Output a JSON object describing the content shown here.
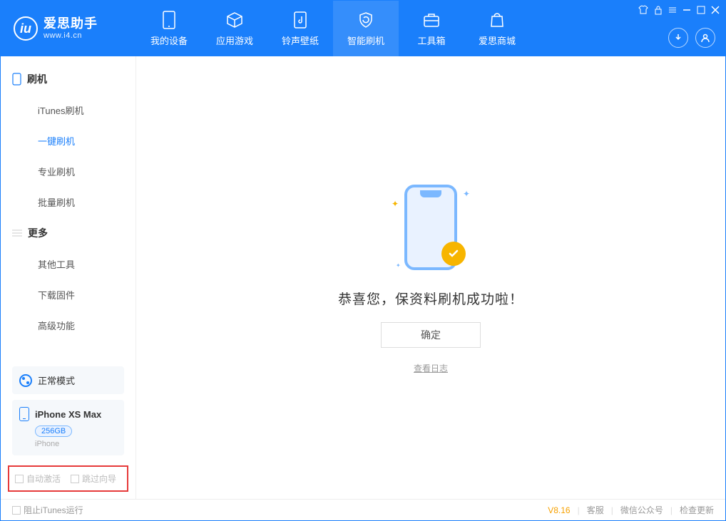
{
  "app": {
    "title": "爱思助手",
    "subtitle": "www.i4.cn"
  },
  "topTabs": [
    {
      "label": "我的设备"
    },
    {
      "label": "应用游戏"
    },
    {
      "label": "铃声壁纸"
    },
    {
      "label": "智能刷机"
    },
    {
      "label": "工具箱"
    },
    {
      "label": "爱思商城"
    }
  ],
  "activeTopTab": 3,
  "sidebar": {
    "section1": {
      "title": "刷机",
      "items": [
        "iTunes刷机",
        "一键刷机",
        "专业刷机",
        "批量刷机"
      ],
      "active": 1
    },
    "section2": {
      "title": "更多",
      "items": [
        "其他工具",
        "下载固件",
        "高级功能"
      ]
    }
  },
  "mode": {
    "label": "正常模式"
  },
  "device": {
    "name": "iPhone XS Max",
    "storage": "256GB",
    "type": "iPhone"
  },
  "checkboxes": {
    "autoActivate": "自动激活",
    "skipGuide": "跳过向导"
  },
  "main": {
    "message": "恭喜您，保资料刷机成功啦！",
    "okButton": "确定",
    "logLink": "查看日志"
  },
  "footer": {
    "blockItunes": "阻止iTunes运行",
    "version": "V8.16",
    "links": [
      "客服",
      "微信公众号",
      "检查更新"
    ]
  }
}
